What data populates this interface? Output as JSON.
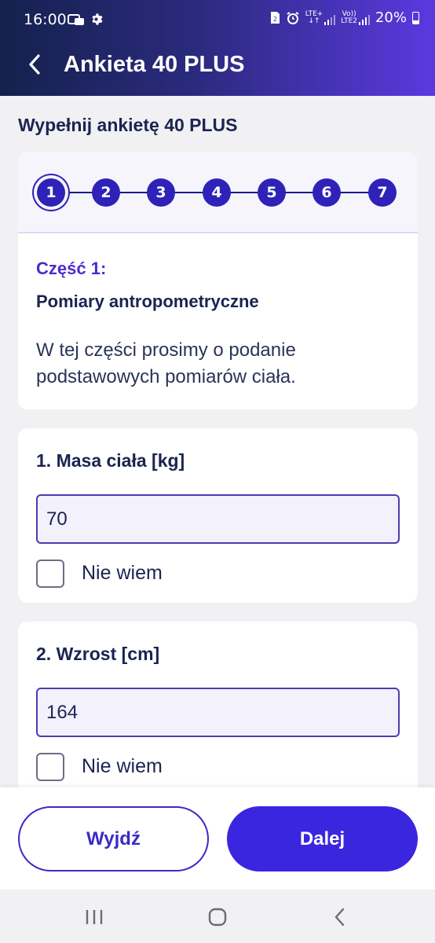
{
  "status_bar": {
    "time": "16:00",
    "lte_label": "LTE+",
    "volte_label": "Vo))",
    "lte2_label": "LTE2",
    "battery": "20%"
  },
  "app_bar": {
    "title": "Ankieta 40 PLUS",
    "back_icon": "chevron-left-icon"
  },
  "page": {
    "title": "Wypełnij ankietę 40 PLUS"
  },
  "stepper": {
    "steps": [
      "1",
      "2",
      "3",
      "4",
      "5",
      "6",
      "7"
    ],
    "active_step": "1"
  },
  "part": {
    "label": "Część 1:",
    "name": "Pomiary antropometryczne",
    "description": "W tej części prosimy o podanie podstawowych pomiarów ciała."
  },
  "questions": [
    {
      "title": "1. Masa ciała [kg]",
      "value": "70",
      "checkbox_label": "Nie wiem",
      "checked": false
    },
    {
      "title": "2. Wzrost [cm]",
      "value": "164",
      "checkbox_label": "Nie wiem",
      "checked": false
    }
  ],
  "actions": {
    "exit_label": "Wyjdź",
    "next_label": "Dalej"
  },
  "colors": {
    "accent": "#3b26e0",
    "header_start": "#14214d",
    "header_end": "#5b39e0",
    "heading_text": "#1b2451"
  }
}
